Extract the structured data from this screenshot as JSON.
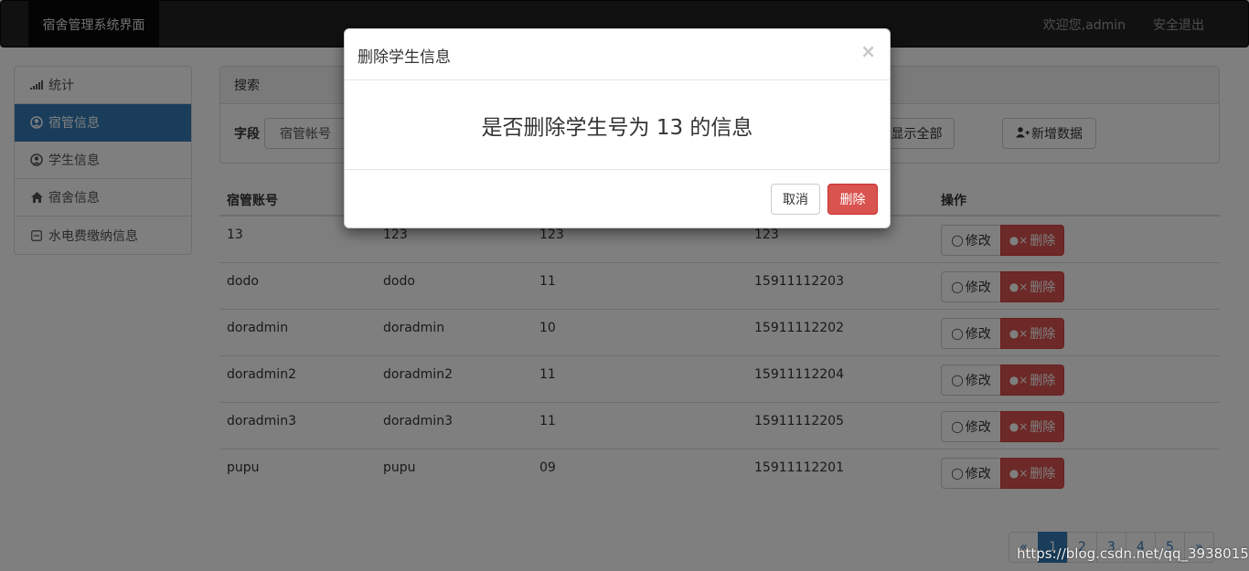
{
  "navbar": {
    "brand": "宿舍管理系统界面",
    "welcome": "欢迎您,admin",
    "logout": "安全退出"
  },
  "sidebar": {
    "items": [
      {
        "label": "统计",
        "icon": "stats-icon"
      },
      {
        "label": "宿管信息",
        "icon": "user-circle-icon",
        "active": true
      },
      {
        "label": "学生信息",
        "icon": "user-circle-icon"
      },
      {
        "label": "宿舍信息",
        "icon": "home-icon"
      },
      {
        "label": "水电费缴纳信息",
        "icon": "minus-square-icon"
      }
    ]
  },
  "search": {
    "title": "搜索",
    "field_label": "字段",
    "field_value": "宿管帐号",
    "show_all": "显示全部",
    "add_new": "新增数据"
  },
  "table": {
    "headers": [
      "宿管账号",
      "",
      "",
      "",
      "操作"
    ],
    "rows": [
      [
        "13",
        "123",
        "123",
        "123"
      ],
      [
        "dodo",
        "dodo",
        "11",
        "15911112203"
      ],
      [
        "doradmin",
        "doradmin",
        "10",
        "15911112202"
      ],
      [
        "doradmin2",
        "doradmin2",
        "11",
        "15911112204"
      ],
      [
        "doradmin3",
        "doradmin3",
        "11",
        "15911112205"
      ],
      [
        "pupu",
        "pupu",
        "09",
        "15911112201"
      ]
    ],
    "edit_label": "修改",
    "delete_label": "删除"
  },
  "pagination": [
    "«",
    "1",
    "2",
    "3",
    "4",
    "5",
    "»"
  ],
  "modal": {
    "title": "删除学生信息",
    "close": "×",
    "message": "是否删除学生号为 13 的信息",
    "cancel": "取消",
    "confirm": "删除"
  },
  "watermark": "https://blog.csdn.net/qq_39380155",
  "colors": {
    "primary": "#337ab7",
    "danger": "#d9534f",
    "navbar": "#222222"
  }
}
